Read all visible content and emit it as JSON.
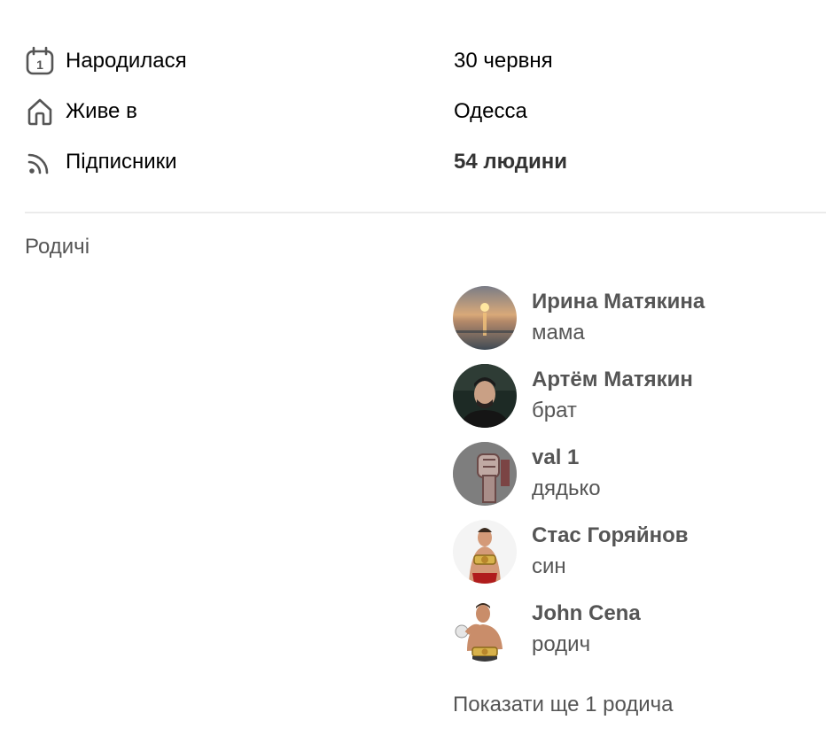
{
  "info": {
    "born": {
      "label": "Народилася",
      "value": "30 червня",
      "icon": "calendar-icon"
    },
    "lives": {
      "label": "Живе в",
      "value": "Одесса",
      "icon": "home-icon"
    },
    "followers": {
      "label": "Підписники",
      "value": "54 людини",
      "icon": "rss-icon"
    }
  },
  "relatives": {
    "title": "Родичі",
    "items": [
      {
        "name": "Ирина Матякина",
        "role": "мама",
        "avatar": "sunset-photo"
      },
      {
        "name": "Артём Матякин",
        "role": "брат",
        "avatar": "man-portrait"
      },
      {
        "name": "val 1",
        "role": "дядько",
        "avatar": "fist-graphic"
      },
      {
        "name": "Стас Горяйнов",
        "role": "син",
        "avatar": "wrestler-photo"
      },
      {
        "name": "John Cena",
        "role": "родич",
        "avatar": "wrestler-champion"
      }
    ],
    "show_more": "Показати ще 1 родича"
  },
  "colors": {
    "text": "#000000",
    "muted": "#555555",
    "divider": "#ebebeb",
    "icon": "#555555"
  }
}
